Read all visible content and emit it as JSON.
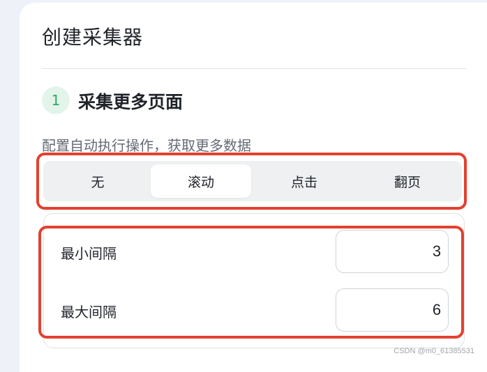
{
  "page": {
    "title": "创建采集器"
  },
  "step": {
    "number": "1",
    "title": "采集更多页面",
    "description": "配置自动执行操作，获取更多数据"
  },
  "actions": {
    "options": [
      "无",
      "滚动",
      "点击",
      "翻页"
    ],
    "selected": "滚动"
  },
  "settings": {
    "min_interval": {
      "label": "最小间隔",
      "value": "3"
    },
    "max_interval": {
      "label": "最大间隔",
      "value": "6"
    }
  },
  "watermark": "CSDN @m0_61385531",
  "colors": {
    "accent_green": "#2fa865",
    "highlight_red": "#e34130"
  },
  "icons": {
    "increment": "chevron-up-icon",
    "decrement": "chevron-down-icon"
  }
}
